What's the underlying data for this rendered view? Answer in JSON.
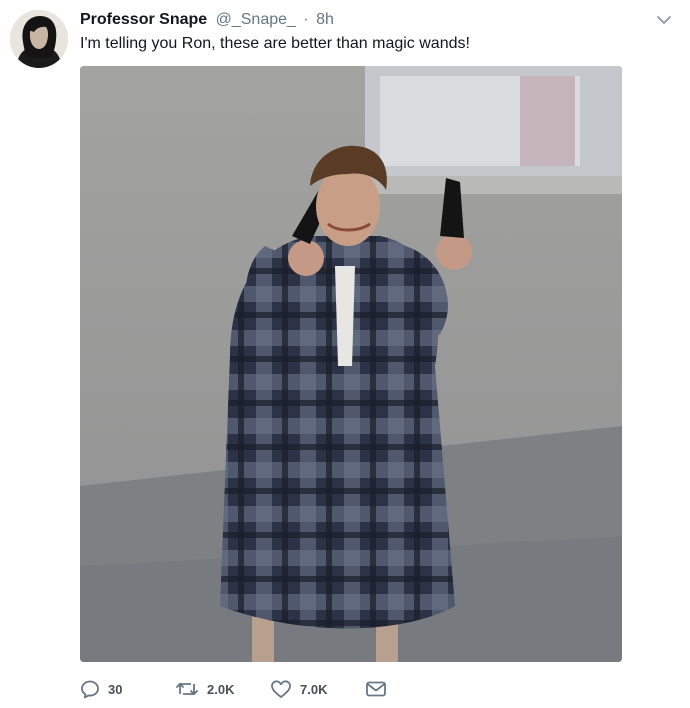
{
  "tweet": {
    "author_name": "Professor Snape",
    "handle": "@_Snape_",
    "separator": "·",
    "time": "8h",
    "text": "I'm telling you Ron, these are better than magic wands!"
  },
  "actions": {
    "reply_count": "30",
    "retweet_count": "2.0K",
    "like_count": "7.0K"
  },
  "icons": {
    "menu": "chevron-down-icon",
    "reply": "reply-icon",
    "retweet": "retweet-icon",
    "like": "heart-icon",
    "dm": "envelope-icon"
  },
  "colors": {
    "text": "#14171a",
    "muted": "#657786",
    "icon": "#657786"
  }
}
